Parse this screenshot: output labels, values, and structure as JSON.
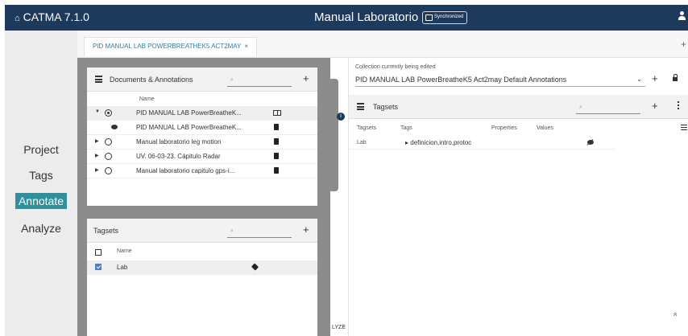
{
  "app": {
    "title": "CATMA 7.1.0",
    "project_title": "Manual Laboratorio",
    "sync_label": "Synchronized"
  },
  "nav": {
    "items": [
      "Project",
      "Tags",
      "Annotate",
      "Analyze"
    ],
    "active": "Annotate"
  },
  "tab": {
    "label": "PID MANUAL LAB POWERBREATHEK5 ACT2MAY",
    "close": "×",
    "add": "+"
  },
  "documents": {
    "title": "Documents & Annotations",
    "search_placeholder": "⌕",
    "col_name": "Name",
    "rows": [
      {
        "name": "PID MANUAL LAB PowerBreatheK...",
        "expanded": true,
        "radio": "on"
      },
      {
        "name": "PID MANUAL LAB PowerBreatheK..."
      },
      {
        "name": "Manual laboratorio leg motion"
      },
      {
        "name": "UV. 06-03-23. Cápitulo Radar"
      },
      {
        "name": "Manual laboratorio capitulo gps-i..."
      }
    ]
  },
  "tagsets_left": {
    "title": "Tagsets",
    "search_placeholder": "⌕",
    "col_name": "Name",
    "rows": [
      {
        "name": "Lab",
        "checked": true
      }
    ]
  },
  "divider": {
    "info": "i",
    "label": "LYZE"
  },
  "collection": {
    "label": "Collection currently being edited",
    "value": "PID MANUAL LAB PowerBreatheK5 Act2may Default Annotations",
    "chevron": "⌄"
  },
  "tagsets_right": {
    "title": "Tagsets",
    "search_placeholder": "⌕",
    "columns": [
      "Tagsets",
      "Tags",
      "Properties",
      "Values"
    ],
    "row": {
      "tagset": "Lab",
      "tags": "definicion,intro,protoc"
    },
    "collapse": "»"
  },
  "colors": {
    "topbar": "#1d3a5c",
    "accent": "#2f8f9d",
    "sidebar": "#ececec"
  }
}
